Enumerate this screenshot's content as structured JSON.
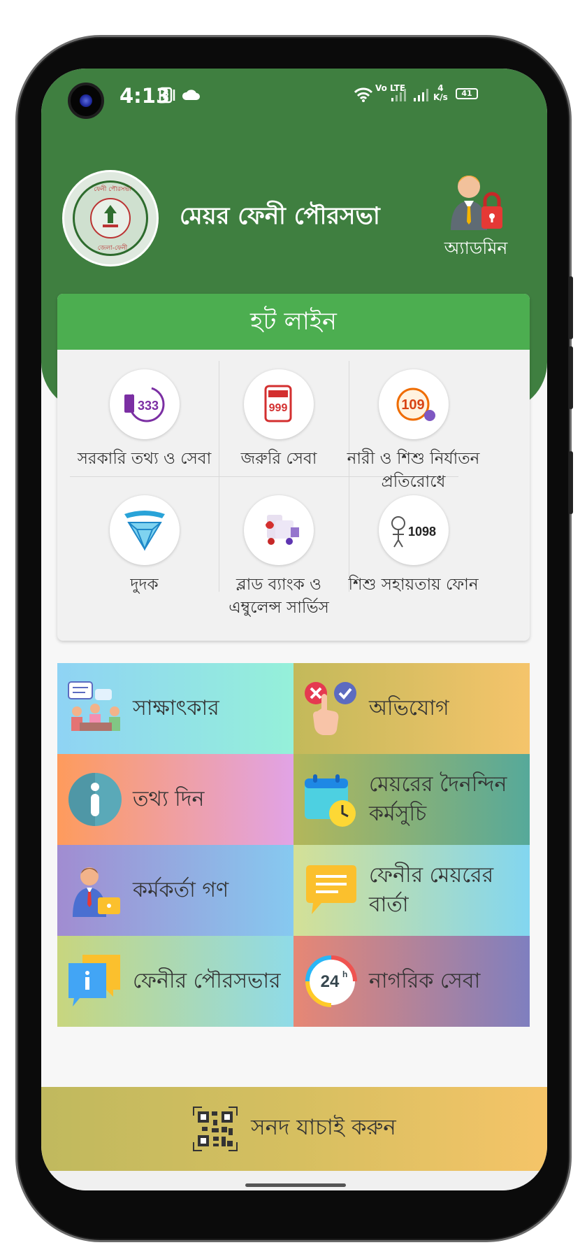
{
  "status_bar": {
    "time": "4:13",
    "network": "Vo LTE",
    "speed_value": "4",
    "speed_unit": "K/s",
    "battery": "41"
  },
  "header": {
    "app_title": "মেয়র ফেনী পৌরসভা",
    "logo_text_top": "ফেনী পৌরসভা",
    "logo_text_bottom": "জেলা-ফেনী",
    "admin_label": "অ্যাডমিন"
  },
  "hotline": {
    "title": "হট লাইন",
    "items": [
      {
        "label": "সরকারি তথ্য ও সেবা",
        "icon": "333-icon",
        "number": "333"
      },
      {
        "label": "জরুরি সেবা",
        "icon": "999-icon",
        "number": "999"
      },
      {
        "label": "নারী ও শিশু নির্যাতন প্রতিরোধে",
        "icon": "109-icon",
        "number": "109"
      },
      {
        "label": "দুদক",
        "icon": "acc-diamond-icon",
        "number": ""
      },
      {
        "label": "ব্লাড ব্যাংক ও এম্বুলেন্স সার্ভিস",
        "icon": "blood-ambulance-icon",
        "number": ""
      },
      {
        "label": "শিশু সহায়তায় ফোন",
        "icon": "1098-icon",
        "number": "1098"
      }
    ]
  },
  "menu": {
    "items": [
      {
        "label": "সাক্ষাৎকার",
        "icon": "meeting-icon"
      },
      {
        "label": "অভিযোগ",
        "icon": "complaint-icon"
      },
      {
        "label": "তথ্য দিন",
        "icon": "info-icon"
      },
      {
        "label": "মেয়রের দৈনন্দিন কর্মসুচি",
        "icon": "calendar-clock-icon"
      },
      {
        "label": "কর্মকর্তা গণ",
        "icon": "officer-icon"
      },
      {
        "label": "ফেনীর মেয়রের বার্তা",
        "icon": "message-icon"
      },
      {
        "label": "ফেনীর পৌরসভার",
        "icon": "info-chat-icon"
      },
      {
        "label": "নাগরিক সেবা",
        "icon": "24h-icon",
        "badge": "24"
      }
    ]
  },
  "banner": {
    "label": "সনদ যাচাই করুন",
    "icon": "qr-code-icon"
  },
  "colors": {
    "header_green": "#3f7f40",
    "hotline_green": "#4cae50"
  }
}
